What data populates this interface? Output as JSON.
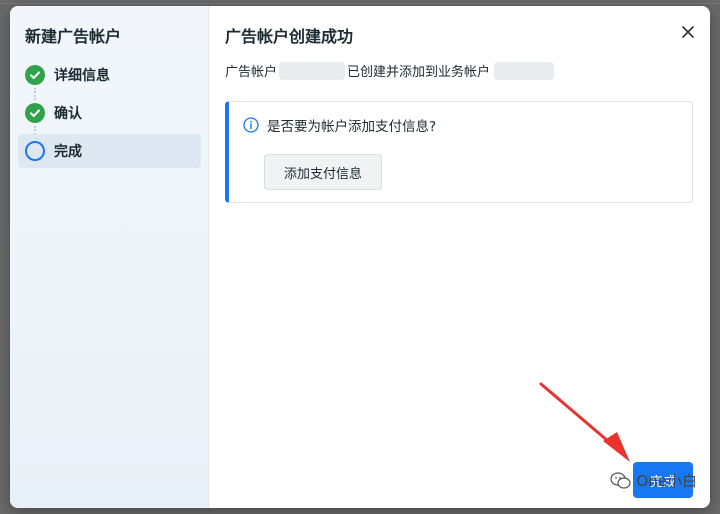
{
  "sidebar": {
    "title": "新建广告帐户",
    "steps": [
      {
        "label": "详细信息",
        "state": "done",
        "icon": "check-circle-icon"
      },
      {
        "label": "确认",
        "state": "done",
        "icon": "check-circle-icon"
      },
      {
        "label": "完成",
        "state": "current",
        "icon": "empty-circle-icon"
      }
    ]
  },
  "main": {
    "title": "广告帐户创建成功",
    "message_part1": "广告帐户",
    "message_part2": "已创建并添加到业务帐户",
    "info_card": {
      "icon": "info-icon",
      "question": "是否要为帐户添加支付信息?",
      "button_label": "添加支付信息"
    },
    "done_button_label": "完成"
  },
  "close_icon": "close-icon",
  "watermark": {
    "text": "One小白",
    "icon": "wechat-icon"
  },
  "colors": {
    "accent": "#1877f2",
    "success": "#31a24c",
    "annotation_arrow": "#e8332f"
  }
}
